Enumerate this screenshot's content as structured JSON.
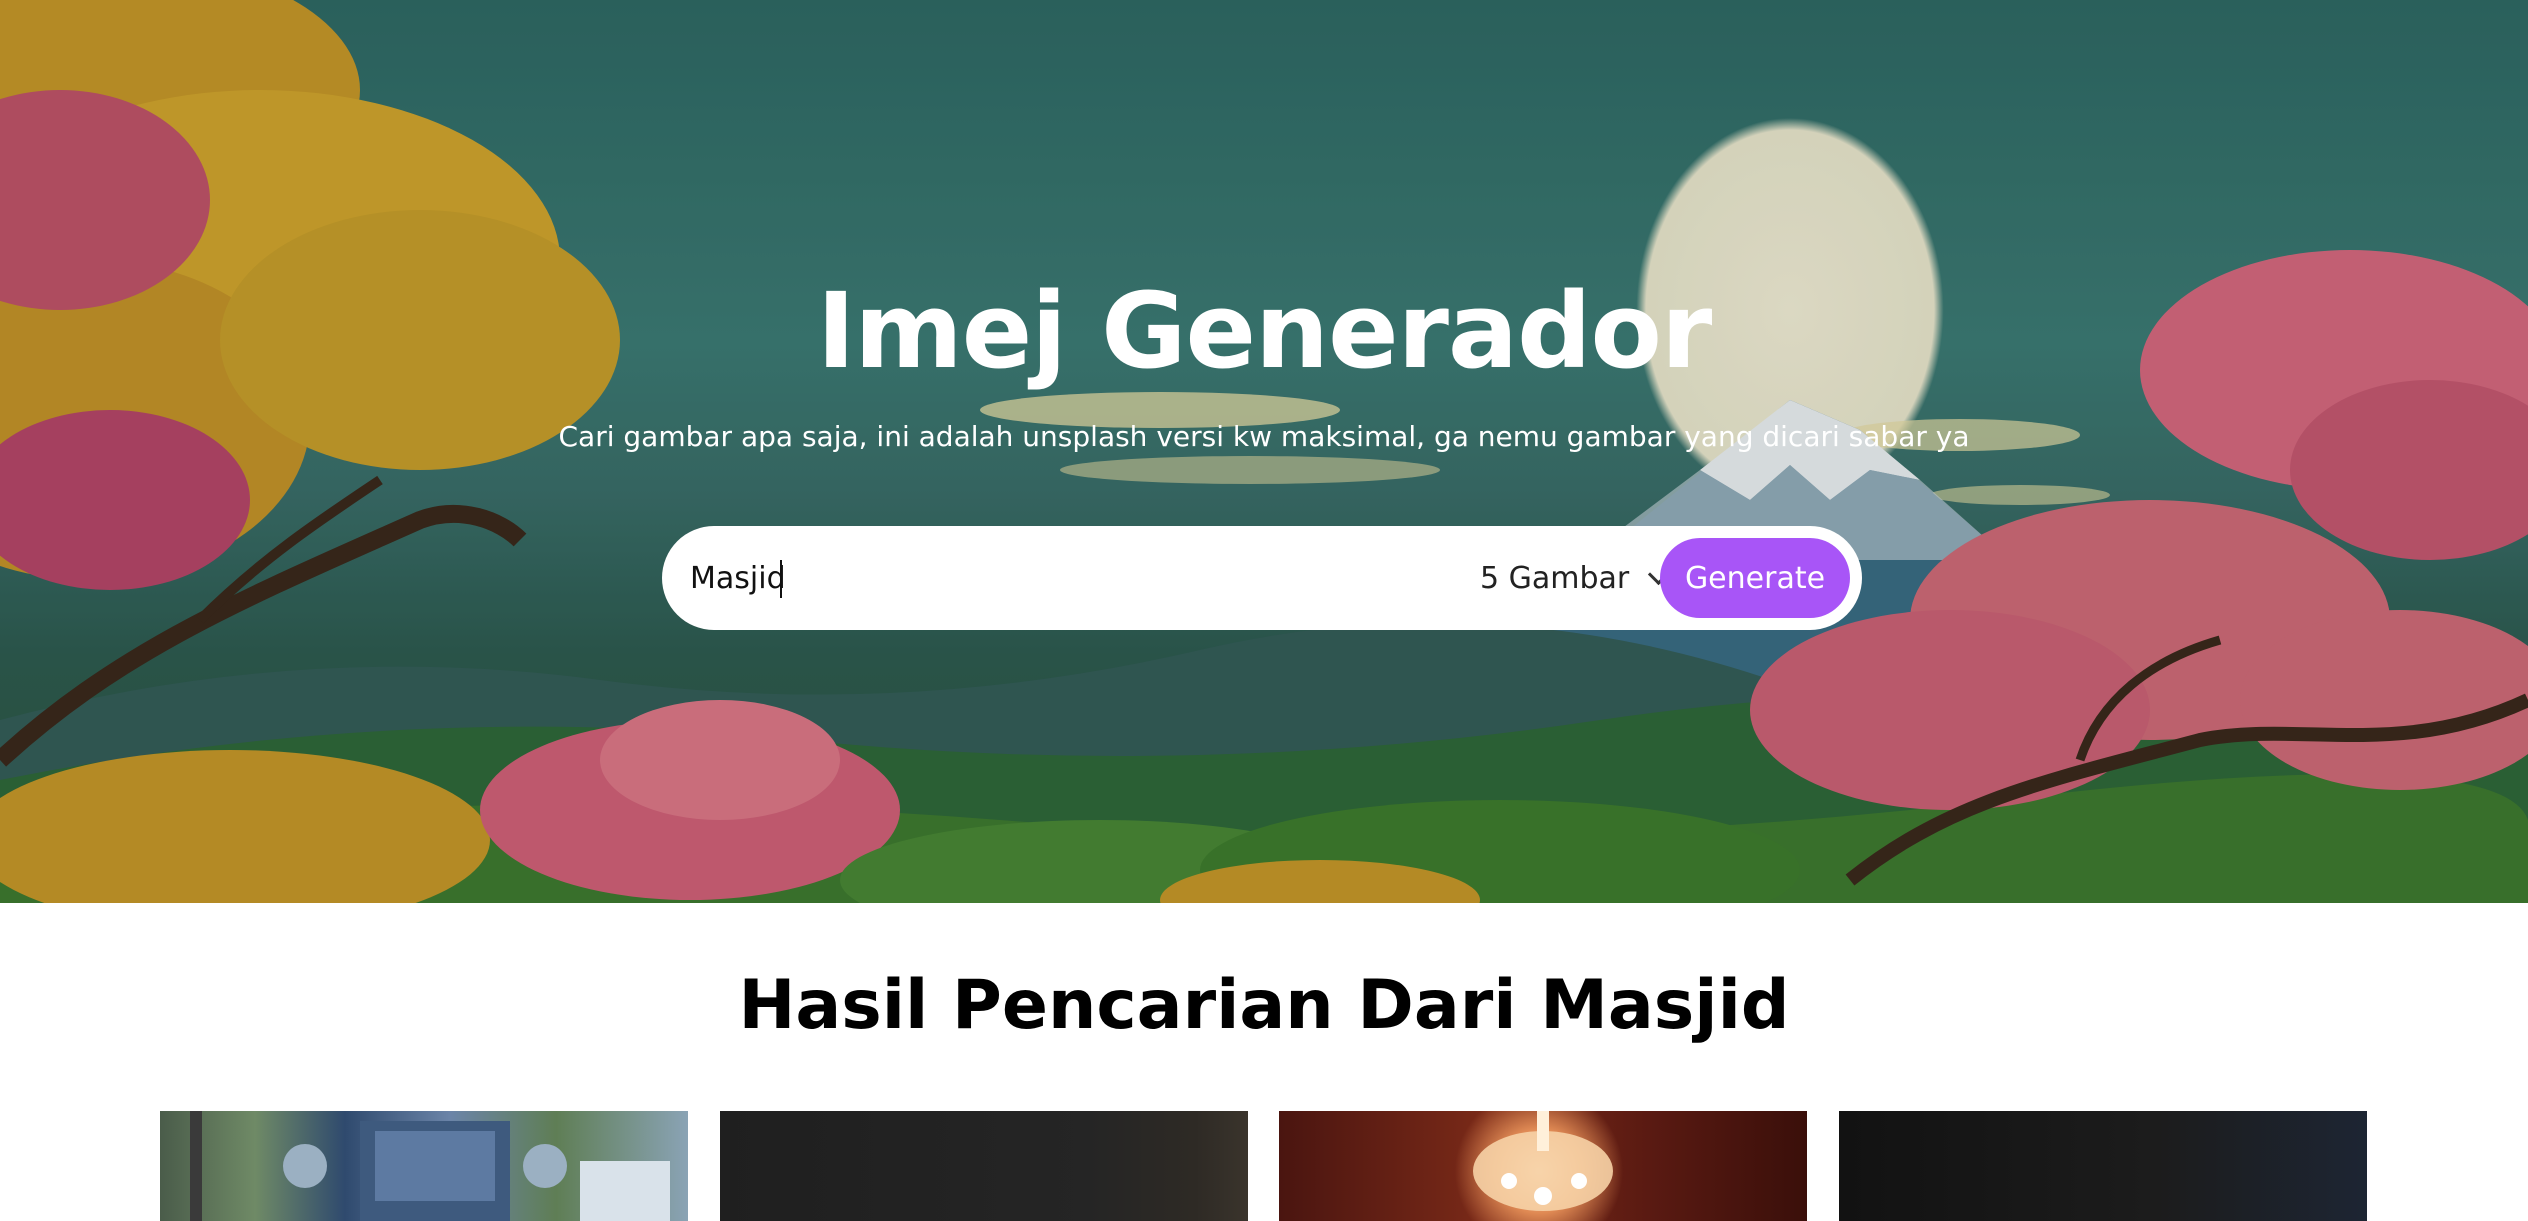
{
  "hero": {
    "title": "Imej Generador",
    "subtitle": "Cari gambar apa saja, ini adalah unsplash versi kw maksimal, ga nemu gambar yang dicari sabar ya"
  },
  "search": {
    "query": "Masjid",
    "count_selected": "5 Gambar",
    "generate_label": "Generate"
  },
  "results": {
    "heading": "Hasil Pencarian Dari Masjid",
    "thumbnails": [
      {
        "name": "mosque-aerial"
      },
      {
        "name": "dark-interior"
      },
      {
        "name": "chandelier-ceiling"
      },
      {
        "name": "dark-photo"
      }
    ]
  },
  "colors": {
    "accent": "#a855f7",
    "hero_bg": "#3d7d76"
  }
}
